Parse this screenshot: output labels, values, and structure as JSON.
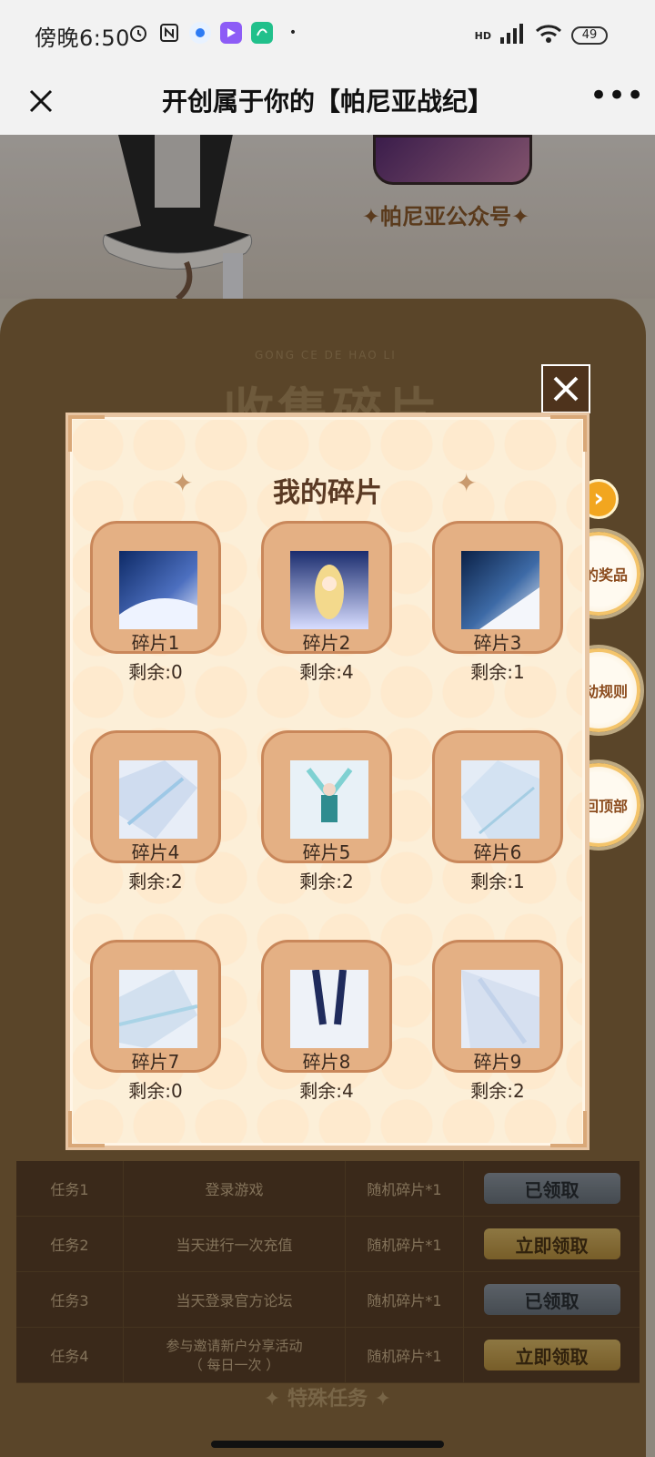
{
  "status_bar": {
    "time": "傍晚6:50",
    "battery": "49",
    "network": "HD",
    "icons": [
      "alarm-icon",
      "nfc-icon",
      "app-dot-blue-icon",
      "app-purple-icon",
      "app-green-icon"
    ]
  },
  "title_bar": {
    "title": "开创属于你的【帕尼亚战纪】",
    "more": "•••"
  },
  "background_page": {
    "official_account_label": "✦帕尼亚公众号✦",
    "collect_title": "收集碎片",
    "collect_subtitle": "GONG CE DE HAO LI",
    "tasks": [
      {
        "id": "任务1",
        "name": "登录游戏",
        "reward": "随机碎片*1",
        "button": "已领取",
        "state": "claimed"
      },
      {
        "id": "任务2",
        "name": "当天进行一次充值",
        "reward": "随机碎片*1",
        "button": "立即领取",
        "state": "available"
      },
      {
        "id": "任务3",
        "name": "当天登录官方论坛",
        "reward": "随机碎片*1",
        "button": "已领取",
        "state": "claimed"
      },
      {
        "id": "任务4",
        "name": "参与邀请新户分享活动\n（ 每日一次 ）",
        "reward": "随机碎片*1",
        "button": "立即领取",
        "state": "available"
      }
    ],
    "special_tasks": "✦ 特殊任务 ✦"
  },
  "side_buttons": {
    "arrow": "›",
    "my_prizes": "我的奖品",
    "rules": "活动规则",
    "back_top": "返回顶部"
  },
  "modal": {
    "title": "我的碎片",
    "close": "✕",
    "fragments": [
      {
        "name": "碎片1",
        "remaining": "剩余:0"
      },
      {
        "name": "碎片2",
        "remaining": "剩余:4"
      },
      {
        "name": "碎片3",
        "remaining": "剩余:1"
      },
      {
        "name": "碎片4",
        "remaining": "剩余:2"
      },
      {
        "name": "碎片5",
        "remaining": "剩余:2"
      },
      {
        "name": "碎片6",
        "remaining": "剩余:1"
      },
      {
        "name": "碎片7",
        "remaining": "剩余:0"
      },
      {
        "name": "碎片8",
        "remaining": "剩余:4"
      },
      {
        "name": "碎片9",
        "remaining": "剩余:2"
      }
    ]
  },
  "colors": {
    "modal_bg": "#fcefd8",
    "card": "#e4b084",
    "accent_gold": "#f2a61f",
    "panel_brown": "#8a6a3f"
  }
}
